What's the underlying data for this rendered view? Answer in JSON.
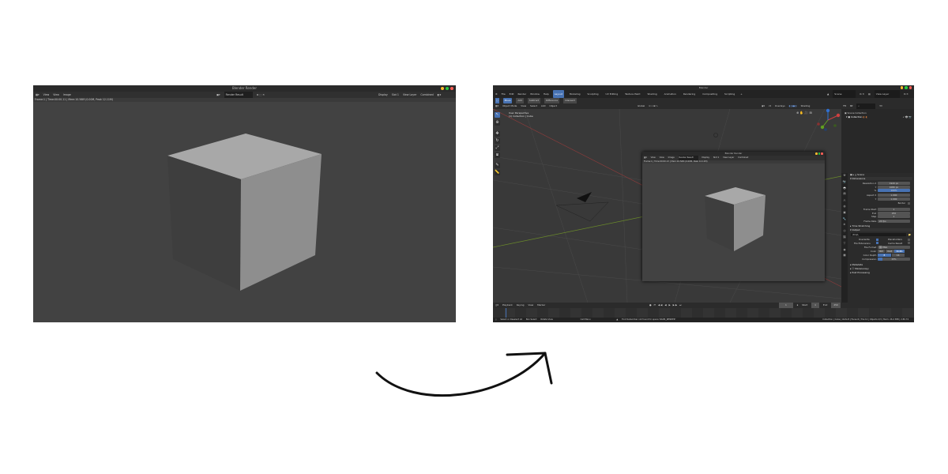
{
  "left_window": {
    "title": "Blender Render",
    "header": {
      "view": "View",
      "view2": "View",
      "image": "Image",
      "slot_name": "Render Result",
      "display": "Display",
      "slot": "Slot 1",
      "view_layer": "View Layer",
      "pass": "Combined"
    },
    "info_line": "Frame:1 | Time:00:00.11 | Mem:10.56M (0.00M, Peak 12.11M)"
  },
  "right_window": {
    "title": "Blender",
    "menu": [
      "File",
      "Edit",
      "Render",
      "Window",
      "Help"
    ],
    "workspace_tabs": [
      "Layout",
      "Modeling",
      "Sculpting",
      "UV Editing",
      "Texture Paint",
      "Shading",
      "Animation",
      "Rendering",
      "Compositing",
      "Scripting"
    ],
    "active_tab": "Layout",
    "scene_label": "Scene",
    "view_layer_label": "View Layer",
    "mode_tabs": [
      "Move",
      "Add",
      "Subtract",
      "Difference",
      "Intersect"
    ],
    "viewport_header": {
      "mode": "Object Mode",
      "view": "View",
      "select": "Select",
      "add": "Add",
      "object": "Object",
      "orientation": "Global",
      "overlays": "Overlays",
      "shading": "Shading"
    },
    "viewport_info": [
      "User Perspective",
      "(1) Collection | Cube"
    ],
    "outliner": {
      "title": "Scene Collection",
      "collection": "Collection"
    },
    "properties": {
      "scene": "Scene",
      "dimensions": "Dimensions",
      "rows": [
        {
          "label": "Resolution X",
          "value": "1920 px"
        },
        {
          "label": "Y",
          "value": "1080 px"
        },
        {
          "label": "%",
          "value": "100%",
          "highlight": true
        },
        {
          "label": "Aspect X",
          "value": "1.000"
        },
        {
          "label": "Y",
          "value": "1.000"
        },
        {
          "label": "Border",
          "value": ""
        },
        {
          "label": "Frame Start",
          "value": "1"
        },
        {
          "label": "End",
          "value": "250"
        },
        {
          "label": "Step",
          "value": "1"
        },
        {
          "label": "Frame Rate",
          "value": "24 fps"
        }
      ],
      "time_stretching": "Time Stretching",
      "output": "Output",
      "output_path": "/tmp\\",
      "overwrite": "Overwrite",
      "placeholders": "Placeholders",
      "file_extensions": "File Extensions",
      "cache_result": "Cache Result",
      "file_format_label": "File Format",
      "file_format": "PNG",
      "color_label": "Color",
      "color_options": [
        "BW",
        "RGB",
        "RGBA"
      ],
      "color_active": "RGBA",
      "color_depth_label": "Color Depth",
      "color_depth_options": [
        "8",
        "16"
      ],
      "compression_label": "Compression",
      "compression": "15%",
      "metadata": "Metadata",
      "stereoscopy": "Stereoscopy",
      "post_processing": "Post Processing"
    },
    "timeline": {
      "playback": "Playback",
      "keying": "Keying",
      "view": "View",
      "marker": "Marker",
      "frame": "1",
      "start_label": "Start",
      "start": "1",
      "end_label": "End",
      "end": "250"
    },
    "status": {
      "select": "Select or Deselect All",
      "box_select": "Box Select",
      "rotate": "Rotate View",
      "call_menu": "Call Menu",
      "warning": "Font Subscriber not found for space 'RAM4_RENDER'",
      "stats": "Collection | Cube | Verts:8 | Faces:6 | Tris:12 | Objects:1/3 | Mem: 26.4 MiB | 2.80.74"
    },
    "render_popup": {
      "title": "Blender Render",
      "info_line": "Frame:1 | Time:00:00.13 | Mem:10.56M (0.00M, Peak 12.11M)"
    }
  },
  "colors": {
    "accent": "#4772b3",
    "close_red": "#ff5f57",
    "min_yellow": "#febc2e",
    "max_green": "#28c840"
  }
}
